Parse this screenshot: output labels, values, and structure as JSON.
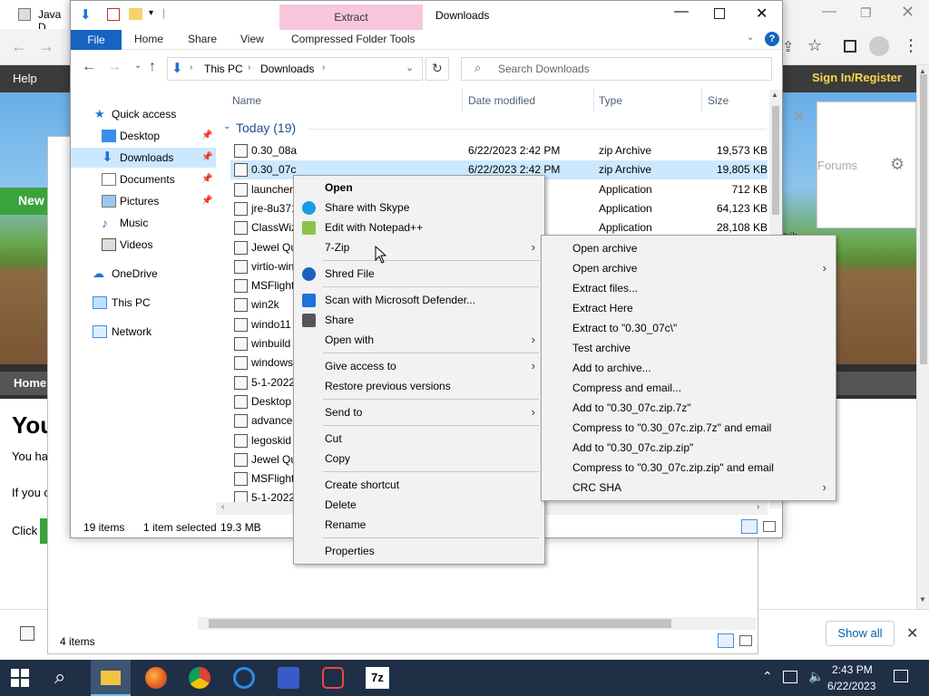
{
  "browser": {
    "tab_title": "Java D",
    "site_nav_help": "Help",
    "sign_in": "Sign In/Register",
    "forums": "Forums",
    "news_btn": "New",
    "home_tab": "Home",
    "heading_fragment": "You",
    "text_fragment_1": "You ha",
    "text_fragment_2": "If you c",
    "text_fragment_3": "Click",
    "attrib_fragment": "ttrib"
  },
  "bg_explorer": {
    "status_items": "4 items",
    "downloads_bar": {
      "show_all": "Show all"
    }
  },
  "explorer": {
    "ribbon_context_tab": "Extract",
    "window_title": "Downloads",
    "tabs": [
      "File",
      "Home",
      "Share",
      "View",
      "Compressed Folder Tools"
    ],
    "breadcrumb": [
      "This PC",
      "Downloads"
    ],
    "search_placeholder": "Search Downloads",
    "nav_pane": [
      {
        "label": "Quick access",
        "icon": "star-icon"
      },
      {
        "label": "Desktop",
        "icon": "desktop-folder-icon",
        "pinned": true
      },
      {
        "label": "Downloads",
        "icon": "downloads-folder-icon",
        "pinned": true,
        "selected": true
      },
      {
        "label": "Documents",
        "icon": "documents-folder-icon",
        "pinned": true
      },
      {
        "label": "Pictures",
        "icon": "pictures-folder-icon",
        "pinned": true
      },
      {
        "label": "Music",
        "icon": "music-folder-icon"
      },
      {
        "label": "Videos",
        "icon": "videos-folder-icon"
      },
      {
        "label": "OneDrive",
        "icon": "cloud-icon"
      },
      {
        "label": "This PC",
        "icon": "computer-icon"
      },
      {
        "label": "Network",
        "icon": "network-icon"
      }
    ],
    "columns": {
      "name": "Name",
      "date": "Date modified",
      "type": "Type",
      "size": "Size"
    },
    "group_header": "Today (19)",
    "files": [
      {
        "name": "0.30_08a",
        "date": "6/22/2023 2:42 PM",
        "type": "zip Archive",
        "size": "19,573 KB"
      },
      {
        "name": "0.30_07c",
        "date": "6/22/2023 2:42 PM",
        "type": "zip Archive",
        "size": "19,805 KB",
        "selected": true
      },
      {
        "name": "launcher",
        "date": "M",
        "type": "Application",
        "size": "712 KB"
      },
      {
        "name": "jre-8u371",
        "date": "M",
        "type": "Application",
        "size": "64,123 KB"
      },
      {
        "name": "ClassWiz",
        "date": "M",
        "type": "Application",
        "size": "28,108 KB"
      },
      {
        "name": "Jewel Qu",
        "date": "",
        "type": "",
        "size": ""
      },
      {
        "name": "virtio-win",
        "date": "",
        "type": "",
        "size": ""
      },
      {
        "name": "MSFlight",
        "date": "",
        "type": "",
        "size": ""
      },
      {
        "name": "win2k",
        "date": "",
        "type": "",
        "size": ""
      },
      {
        "name": "windo11",
        "date": "",
        "type": "",
        "size": ""
      },
      {
        "name": "winbuild",
        "date": "",
        "type": "",
        "size": ""
      },
      {
        "name": "windows",
        "date": "",
        "type": "",
        "size": ""
      },
      {
        "name": "5-1-2022",
        "date": "",
        "type": "",
        "size": ""
      },
      {
        "name": "Desktop",
        "date": "",
        "type": "",
        "size": ""
      },
      {
        "name": "advance",
        "date": "",
        "type": "",
        "size": ""
      },
      {
        "name": "legoskid",
        "date": "",
        "type": "",
        "size": ""
      },
      {
        "name": "Jewel Qu",
        "date": "",
        "type": "",
        "size": ""
      },
      {
        "name": "MSFlight",
        "date": "",
        "type": "",
        "size": ""
      },
      {
        "name": "5-1-2022",
        "date": "",
        "type": "",
        "size": ""
      }
    ],
    "status": {
      "count": "19 items",
      "selected": "1 item selected",
      "size": "19.3 MB"
    }
  },
  "context_menu": {
    "items": [
      {
        "label": "Open",
        "bold": true
      },
      {
        "label": "Share with Skype",
        "icon": "skype-icon"
      },
      {
        "label": "Edit with Notepad++",
        "icon": "notepadpp-icon"
      },
      {
        "label": "7-Zip",
        "submenu": true
      },
      {
        "sep": true
      },
      {
        "label": "Shred File",
        "icon": "shred-icon"
      },
      {
        "sep": true
      },
      {
        "label": "Scan with Microsoft Defender...",
        "icon": "defender-icon"
      },
      {
        "label": "Share",
        "icon": "share-icon"
      },
      {
        "label": "Open with",
        "submenu": true
      },
      {
        "sep": true
      },
      {
        "label": "Give access to",
        "submenu": true
      },
      {
        "label": "Restore previous versions"
      },
      {
        "sep": true
      },
      {
        "label": "Send to",
        "submenu": true
      },
      {
        "sep": true
      },
      {
        "label": "Cut"
      },
      {
        "label": "Copy"
      },
      {
        "sep": true
      },
      {
        "label": "Create shortcut"
      },
      {
        "label": "Delete"
      },
      {
        "label": "Rename"
      },
      {
        "sep": true
      },
      {
        "label": "Properties"
      }
    ]
  },
  "zip_submenu": {
    "items": [
      {
        "label": "Open archive"
      },
      {
        "label": "Open archive",
        "submenu": true
      },
      {
        "label": "Extract files..."
      },
      {
        "label": "Extract Here"
      },
      {
        "label": "Extract to \"0.30_07c\\\""
      },
      {
        "label": "Test archive"
      },
      {
        "label": "Add to archive..."
      },
      {
        "label": "Compress and email..."
      },
      {
        "label": "Add to \"0.30_07c.zip.7z\""
      },
      {
        "label": "Compress to \"0.30_07c.zip.7z\" and email"
      },
      {
        "label": "Add to \"0.30_07c.zip.zip\""
      },
      {
        "label": "Compress to \"0.30_07c.zip.zip\" and email"
      },
      {
        "label": "CRC SHA",
        "submenu": true
      }
    ]
  },
  "taskbar": {
    "time": "2:43 PM",
    "date": "6/22/2023",
    "apps": [
      "file-explorer-icon",
      "firefox-icon",
      "chrome-icon",
      "ccleaner-icon",
      "vm-icon",
      "recorder-icon",
      "7zip-icon"
    ]
  },
  "colors": {
    "accent": "#0063b1",
    "selection": "#cce8ff",
    "extract_tab": "#f8c6dd",
    "taskbar": "#1f2f45",
    "green_button": "#3aa33a"
  }
}
